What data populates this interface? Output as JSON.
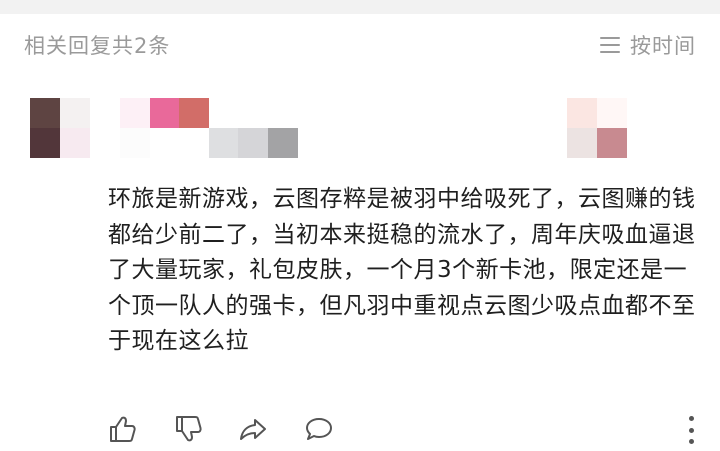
{
  "header": {
    "reply_count": "相关回复共2条",
    "sort_label": "按时间",
    "sort_icon": "sort-lines-icon"
  },
  "comment": {
    "text": "环旅是新游戏，云图存粹是被羽中给吸死了，云图赚的钱都给少前二了，当初本来挺稳的流水了，周年庆吸血逼退了大量玩家，礼包皮肤，一个月3个新卡池，限定还是一个顶一队人的强卡，但凡羽中重视点云图少吸点血都不至于现在这么拉"
  },
  "mosaic_colors": {
    "avatar": [
      "#5e4442",
      "#f4f1f1",
      "#52363a",
      "#f7eaf0"
    ],
    "username": [
      "#fdf0f6",
      "#e9699a",
      "#d26d68",
      "#ffffff",
      "#ffffff",
      "#ffffff",
      "#fcfcfc",
      "#ffffff",
      "#ffffff",
      "#dedfe1",
      "#d5d5d8",
      "#a3a3a5"
    ],
    "right": [
      "#ffffff",
      "#fbe6e2",
      "#fff7f6",
      "#ffffff",
      "#ece3e2",
      "#c88a90"
    ]
  },
  "actions": {
    "icons": [
      "thumbs-up-icon",
      "thumbs-down-icon",
      "share-icon",
      "comment-icon",
      "more-vertical-icon"
    ],
    "icon_color": "#555555"
  }
}
